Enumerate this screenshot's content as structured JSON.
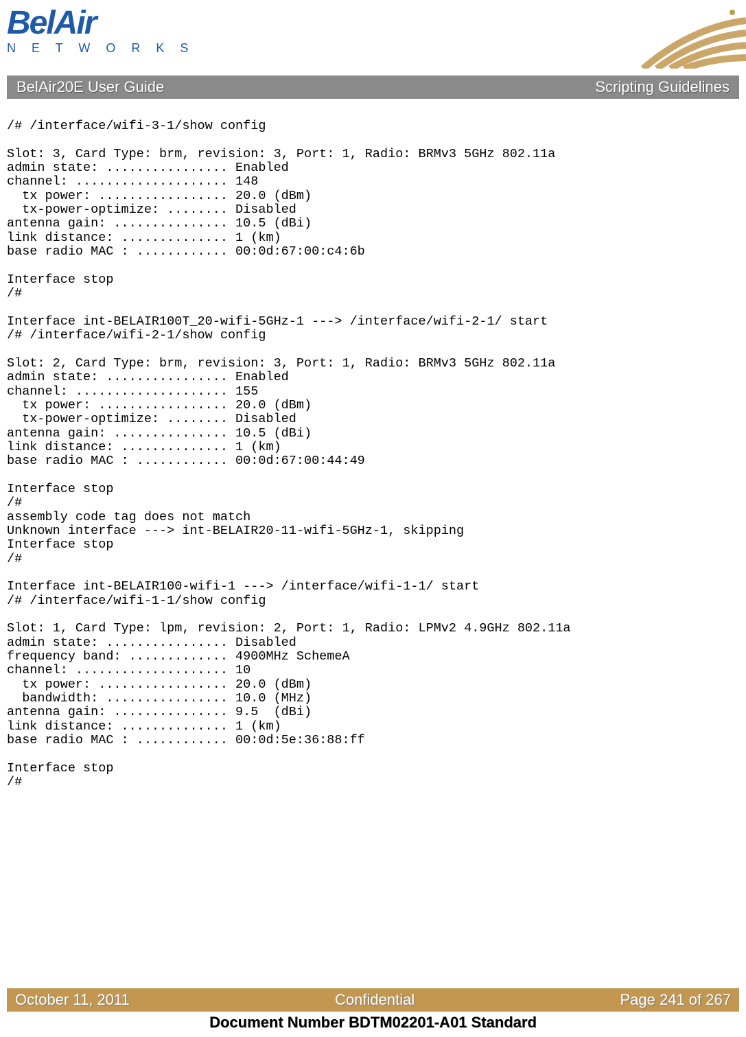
{
  "header": {
    "logo_top": "BelAir",
    "logo_bottom": "N E T W O R K S"
  },
  "titlebar": {
    "left": "BelAir20E User Guide",
    "right": "Scripting Guidelines"
  },
  "terminal": "/# /interface/wifi-3-1/show config\n\nSlot: 3, Card Type: brm, revision: 3, Port: 1, Radio: BRMv3 5GHz 802.11a\nadmin state: ................ Enabled\nchannel: .................... 148\n  tx power: ................. 20.0 (dBm)\n  tx-power-optimize: ........ Disabled\nantenna gain: ............... 10.5 (dBi)\nlink distance: .............. 1 (km)\nbase radio MAC : ............ 00:0d:67:00:c4:6b\n\nInterface stop\n/#\n\nInterface int-BELAIR100T_20-wifi-5GHz-1 ---> /interface/wifi-2-1/ start\n/# /interface/wifi-2-1/show config\n\nSlot: 2, Card Type: brm, revision: 3, Port: 1, Radio: BRMv3 5GHz 802.11a\nadmin state: ................ Enabled\nchannel: .................... 155\n  tx power: ................. 20.0 (dBm)\n  tx-power-optimize: ........ Disabled\nantenna gain: ............... 10.5 (dBi)\nlink distance: .............. 1 (km)\nbase radio MAC : ............ 00:0d:67:00:44:49\n\nInterface stop\n/#\nassembly code tag does not match\nUnknown interface ---> int-BELAIR20-11-wifi-5GHz-1, skipping\nInterface stop\n/#\n\nInterface int-BELAIR100-wifi-1 ---> /interface/wifi-1-1/ start\n/# /interface/wifi-1-1/show config\n\nSlot: 1, Card Type: lpm, revision: 2, Port: 1, Radio: LPMv2 4.9GHz 802.11a\nadmin state: ................ Disabled\nfrequency band: ............. 4900MHz SchemeA\nchannel: .................... 10\n  tx power: ................. 20.0 (dBm)\n  bandwidth: ................ 10.0 (MHz)\nantenna gain: ............... 9.5  (dBi)\nlink distance: .............. 1 (km)\nbase radio MAC : ............ 00:0d:5e:36:88:ff\n\nInterface stop\n/#",
  "footer": {
    "left": "October 11, 2011",
    "center": "Confidential",
    "right": "Page 241 of 267",
    "docnum": "Document Number BDTM02201-A01 Standard"
  }
}
